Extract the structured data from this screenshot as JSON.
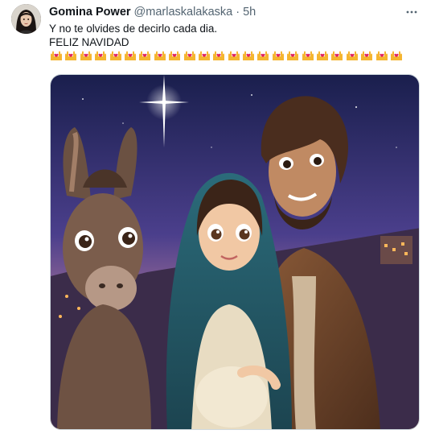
{
  "author": {
    "display_name": "Gomina Power",
    "handle": "@marlaskalakaska",
    "separator": "·",
    "time": "5h"
  },
  "tweet": {
    "lines": [
      "Y no te olvides de decirlo cada dia.",
      "FELIZ NAVIDAD"
    ],
    "emoji_count": 24,
    "emoji": "heart-hands-emoji"
  },
  "icons": {
    "more": "more-horizontal-icon"
  },
  "colors": {
    "text": "#0f1419",
    "secondary": "#536471",
    "border": "#cfd9de"
  }
}
